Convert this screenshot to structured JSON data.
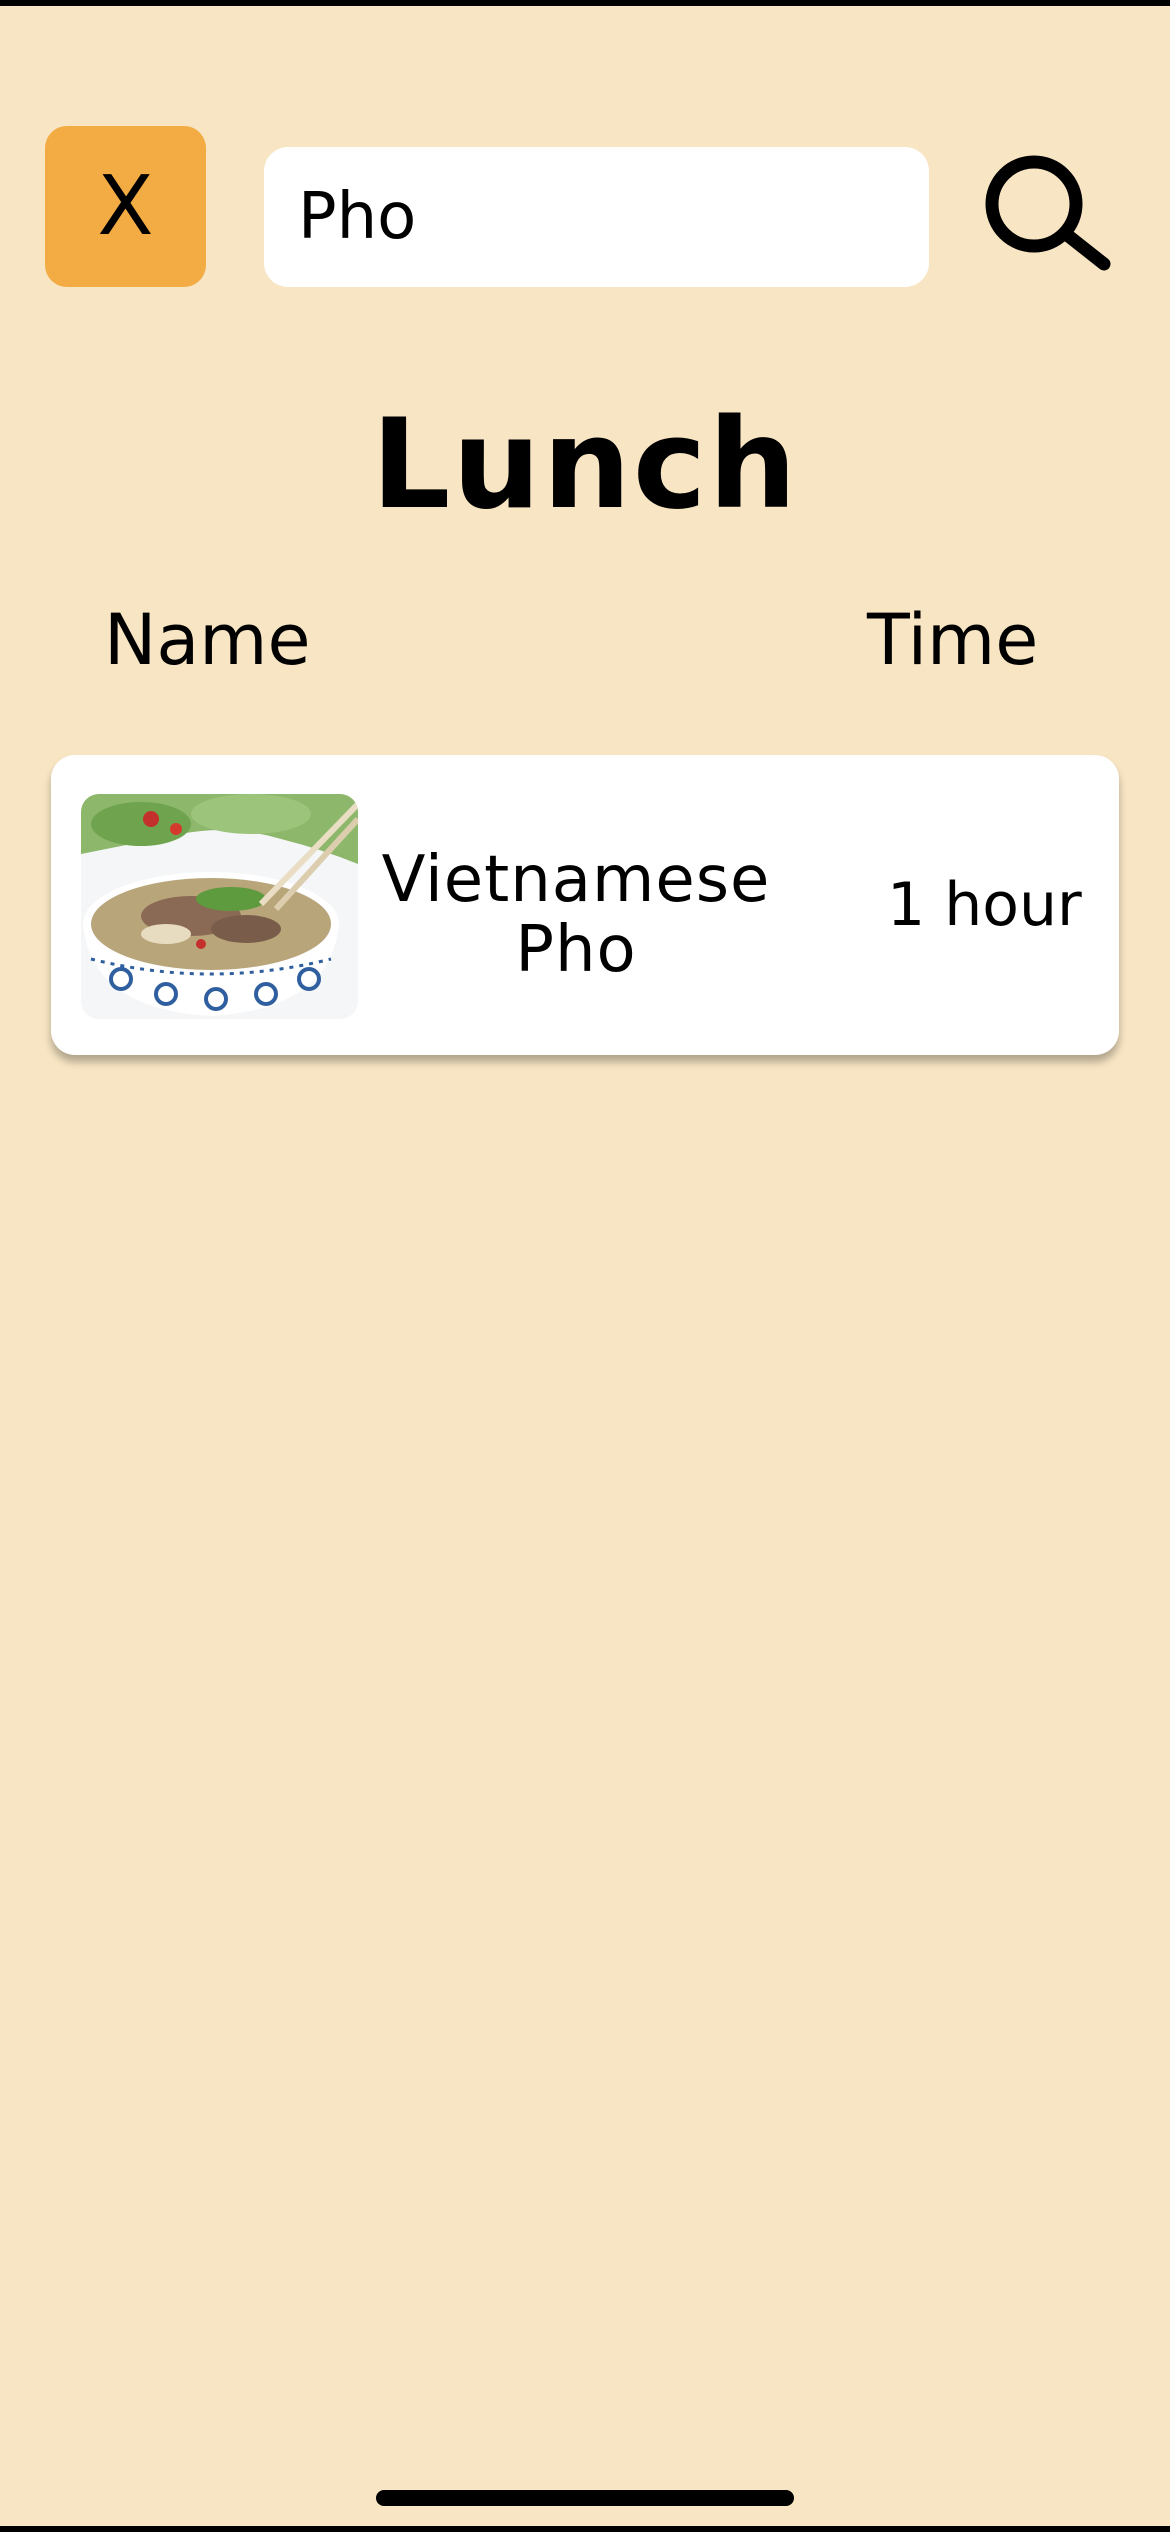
{
  "header": {
    "close_label": "X",
    "search": {
      "value": "Pho",
      "placeholder": ""
    },
    "search_icon": "search-icon"
  },
  "page_title": "Lunch",
  "columns": {
    "name": "Name",
    "time": "Time"
  },
  "recipes": [
    {
      "name": "Vietnamese Pho",
      "time": "1 hour",
      "image": "pho-bowl-photo"
    }
  ],
  "colors": {
    "background": "#F7E5C3",
    "accent": "#F2AC43",
    "card": "#FFFFFF",
    "text": "#000000"
  }
}
